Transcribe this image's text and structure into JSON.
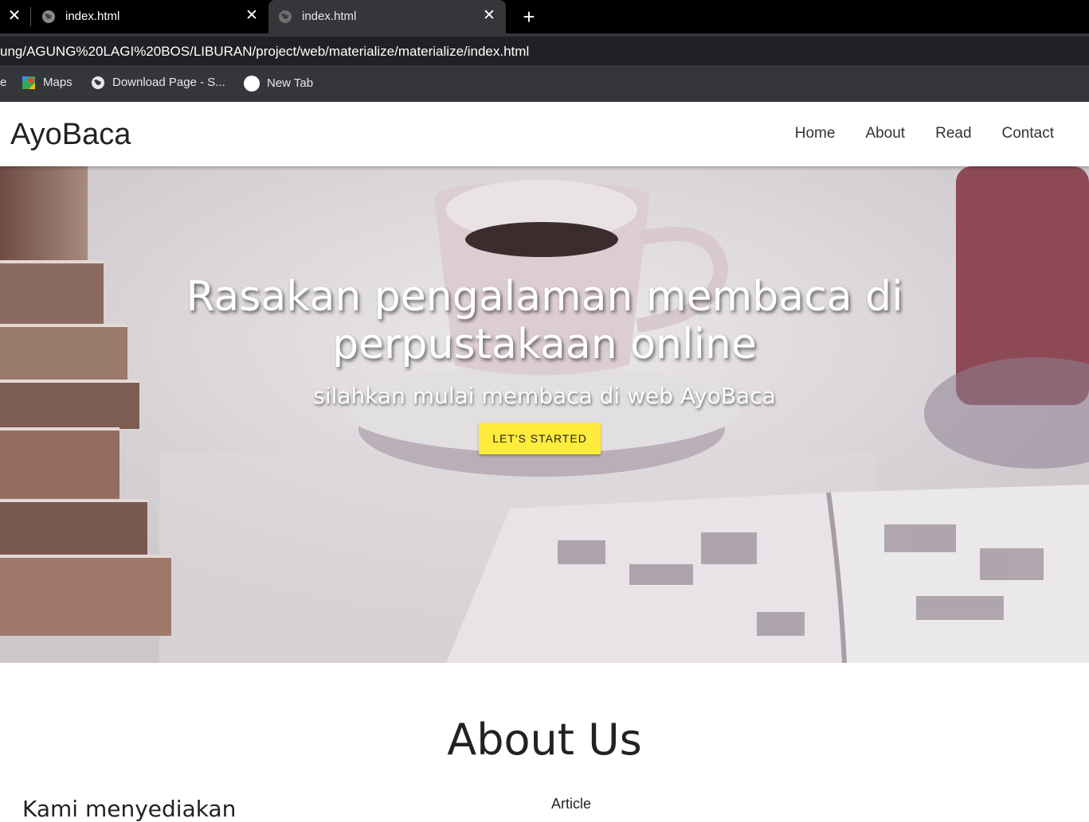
{
  "browser": {
    "tabs": [
      {
        "title": "index.html",
        "active": false
      },
      {
        "title": "index.html",
        "active": true
      }
    ],
    "url": "ung/AGUNG%20LAGI%20BOS/LIBURAN/project/web/materialize/materialize/index.html",
    "bookmarks": [
      {
        "label": "e"
      },
      {
        "label": "Maps",
        "icon": "maps-icon"
      },
      {
        "label": "Download Page - S...",
        "icon": "globe-icon"
      },
      {
        "label": "New Tab",
        "icon": "circle-icon"
      }
    ]
  },
  "site": {
    "brand": "AyoBaca",
    "nav": [
      "Home",
      "About",
      "Read",
      "Contact"
    ],
    "hero": {
      "title_line1": "Rasakan pengalaman membaca di",
      "title_line2": "perpustakaan online",
      "subtitle": "silahkan mulai membaca di web AyoBaca",
      "cta": "LET'S STARTED"
    },
    "about": {
      "title": "About Us",
      "left_heading": "Kami menyediakan",
      "right_label": "Article"
    }
  },
  "colors": {
    "accent_button": "#ffeb3b",
    "tabstrip": "#000000",
    "toolbar": "#35363a"
  }
}
